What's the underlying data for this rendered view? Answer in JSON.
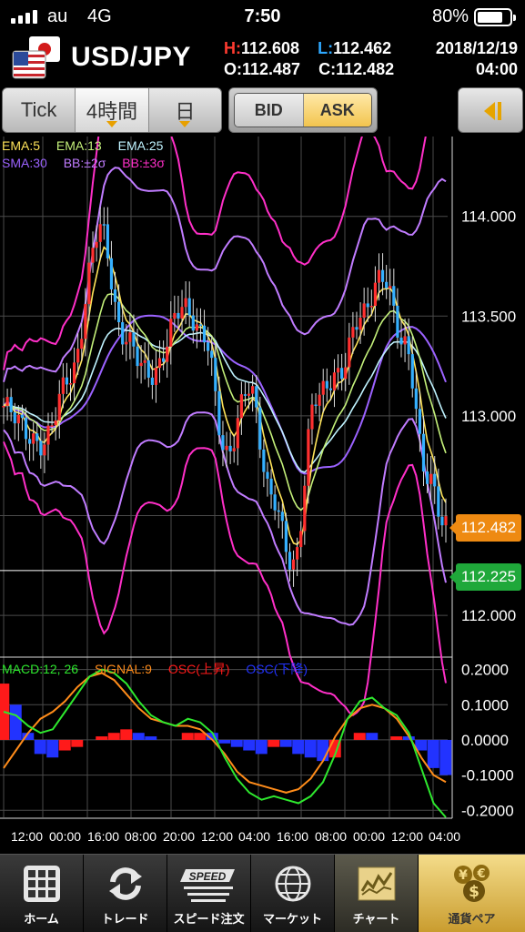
{
  "status_bar": {
    "carrier": "au",
    "network": "4G",
    "time": "7:50",
    "battery": "80%",
    "battery_level": 0.8
  },
  "header": {
    "pair": "USD/JPY",
    "high_key": "H:",
    "high": "112.608",
    "low_key": "L:",
    "low": "112.462",
    "open_key": "O:",
    "open": "112.487",
    "close_key": "C:",
    "close": "112.482",
    "date": "2018/12/19",
    "time": "04:00"
  },
  "toolbar": {
    "tick_label": "Tick",
    "timeframe_label": "4時間",
    "period_label": "日",
    "bid_label": "BID",
    "ask_label": "ASK",
    "selected_side": "ASK"
  },
  "chart": {
    "price_legend": [
      {
        "label": "EMA:5",
        "color": "#ffe45a"
      },
      {
        "label": "EMA:13",
        "color": "#c4f07a"
      },
      {
        "label": "EMA:25",
        "color": "#bff3ff"
      },
      {
        "label": "SMA:30",
        "color": "#9b62ff"
      },
      {
        "label": "BB:±2σ",
        "color": "#c07cff"
      },
      {
        "label": "BB:±3σ",
        "color": "#ff2fc8"
      }
    ],
    "price_axis_ticks": [
      "114.000",
      "113.500",
      "113.000",
      "112.000"
    ],
    "ask_price": "112.482",
    "bid_price": "112.225",
    "macd_legend": [
      {
        "label": "MACD:12, 26",
        "color": "#2ee82e"
      },
      {
        "label": "SIGNAL:9",
        "color": "#ff8c1a"
      },
      {
        "label": "OSC(上昇)",
        "color": "#ff1a1a"
      },
      {
        "label": "OSC(下降)",
        "color": "#2233ff"
      }
    ],
    "macd_axis_ticks": [
      "0.2000",
      "0.1000",
      "0.0000",
      "-0.1000",
      "-0.2000"
    ],
    "time_labels": [
      "12:00",
      "00:00",
      "16:00",
      "08:00",
      "20:00",
      "12:00",
      "04:00",
      "16:00",
      "08:00",
      "00:00",
      "12:00",
      "04:00"
    ],
    "colors": {
      "up": "#ff3030",
      "down": "#35b0ff",
      "grid": "#4a4a4a"
    }
  },
  "chart_data": {
    "type": "candlestick",
    "price_ylim": [
      111.8,
      114.4
    ],
    "macd_ylim": [
      -0.22,
      0.23
    ],
    "macd_values": [
      0.08,
      0.07,
      0.04,
      0.02,
      0.03,
      0.08,
      0.13,
      0.18,
      0.2,
      0.19,
      0.16,
      0.11,
      0.07,
      0.05,
      0.04,
      0.06,
      0.05,
      0.02,
      -0.05,
      -0.11,
      -0.15,
      -0.17,
      -0.16,
      -0.17,
      -0.18,
      -0.16,
      -0.12,
      -0.04,
      0.06,
      0.11,
      0.12,
      0.09,
      0.07,
      0.02,
      -0.08,
      -0.18,
      -0.22
    ],
    "signal_values": [
      -0.08,
      -0.03,
      0.02,
      0.06,
      0.08,
      0.11,
      0.15,
      0.18,
      0.19,
      0.17,
      0.13,
      0.09,
      0.06,
      0.05,
      0.04,
      0.04,
      0.03,
      0.0,
      -0.04,
      -0.09,
      -0.12,
      -0.13,
      -0.14,
      -0.15,
      -0.14,
      -0.11,
      -0.06,
      0.01,
      0.06,
      0.09,
      0.1,
      0.09,
      0.06,
      0.01,
      -0.05,
      -0.1,
      -0.12
    ]
  },
  "tab_bar": {
    "items": [
      {
        "label": "ホーム",
        "icon": "home-grid-icon"
      },
      {
        "label": "トレード",
        "icon": "trade-arrows-icon"
      },
      {
        "label": "スピード注文",
        "icon": "speed-icon"
      },
      {
        "label": "マーケット",
        "icon": "globe-icon"
      },
      {
        "label": "チャート",
        "icon": "chart-icon"
      },
      {
        "label": "通貨ペア",
        "icon": "currency-icon"
      }
    ],
    "speed_icon_text": "SPEED",
    "selected": "チャート"
  }
}
